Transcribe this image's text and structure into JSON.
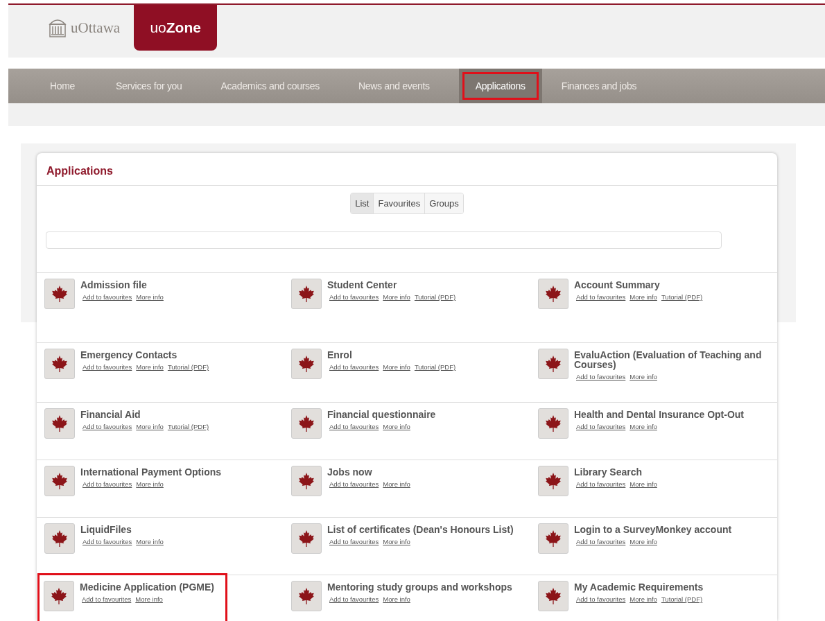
{
  "header": {
    "logo_text": "uOttawa",
    "brand_prefix": "uo",
    "brand_name": "Zone"
  },
  "nav": [
    {
      "label": "Home",
      "selected": false,
      "highlighted": false
    },
    {
      "label": "Services for you",
      "selected": false,
      "highlighted": false
    },
    {
      "label": "Academics and courses",
      "selected": false,
      "highlighted": false
    },
    {
      "label": "News and events",
      "selected": false,
      "highlighted": false
    },
    {
      "label": "Applications",
      "selected": true,
      "highlighted": true
    },
    {
      "label": "Finances and jobs",
      "selected": false,
      "highlighted": false
    }
  ],
  "panel": {
    "title": "Applications",
    "view_tabs": [
      {
        "label": "List",
        "selected": true
      },
      {
        "label": "Favourites",
        "selected": false
      },
      {
        "label": "Groups",
        "selected": false
      }
    ],
    "apps": [
      {
        "name": "Admission file",
        "links": [
          "Add to favourites",
          "More info"
        ],
        "highlighted": false
      },
      {
        "name": "Student Center",
        "links": [
          "Add to favourites",
          "More info",
          "Tutorial (PDF)"
        ],
        "highlighted": false
      },
      {
        "name": "Account Summary",
        "links": [
          "Add to favourites",
          "More info",
          "Tutorial (PDF)"
        ],
        "highlighted": false
      },
      {
        "name": "Emergency Contacts",
        "links": [
          "Add to favourites",
          "More info",
          "Tutorial (PDF)"
        ],
        "highlighted": false
      },
      {
        "name": "Enrol",
        "links": [
          "Add to favourites",
          "More info",
          "Tutorial (PDF)"
        ],
        "highlighted": false
      },
      {
        "name": "EvaluAction (Evaluation of Teaching and Courses)",
        "links": [
          "Add to favourites",
          "More info"
        ],
        "highlighted": false
      },
      {
        "name": "Financial Aid",
        "links": [
          "Add to favourites",
          "More info",
          "Tutorial (PDF)"
        ],
        "highlighted": false
      },
      {
        "name": "Financial questionnaire",
        "links": [
          "Add to favourites",
          "More info"
        ],
        "highlighted": false
      },
      {
        "name": "Health and Dental Insurance Opt-Out",
        "links": [
          "Add to favourites",
          "More info"
        ],
        "highlighted": false
      },
      {
        "name": "International Payment Options",
        "links": [
          "Add to favourites",
          "More info"
        ],
        "highlighted": false
      },
      {
        "name": "Jobs now",
        "links": [
          "Add to favourites",
          "More info"
        ],
        "highlighted": false
      },
      {
        "name": "Library Search",
        "links": [
          "Add to favourites",
          "More info"
        ],
        "highlighted": false
      },
      {
        "name": "LiquidFiles",
        "links": [
          "Add to favourites",
          "More info"
        ],
        "highlighted": false
      },
      {
        "name": "List of certificates (Dean's Honours List)",
        "links": [
          "Add to favourites",
          "More info"
        ],
        "highlighted": false
      },
      {
        "name": "Login to a SurveyMonkey account",
        "links": [
          "Add to favourites",
          "More info"
        ],
        "highlighted": false
      },
      {
        "name": "Medicine Application (PGME)",
        "links": [
          "Add to favourites",
          "More info"
        ],
        "highlighted": true
      },
      {
        "name": "Mentoring study groups and workshops",
        "links": [
          "Add to favourites",
          "More info"
        ],
        "highlighted": false
      },
      {
        "name": "My Academic Requirements",
        "links": [
          "Add to favourites",
          "More info",
          "Tutorial (PDF)"
        ],
        "highlighted": false
      }
    ]
  }
}
